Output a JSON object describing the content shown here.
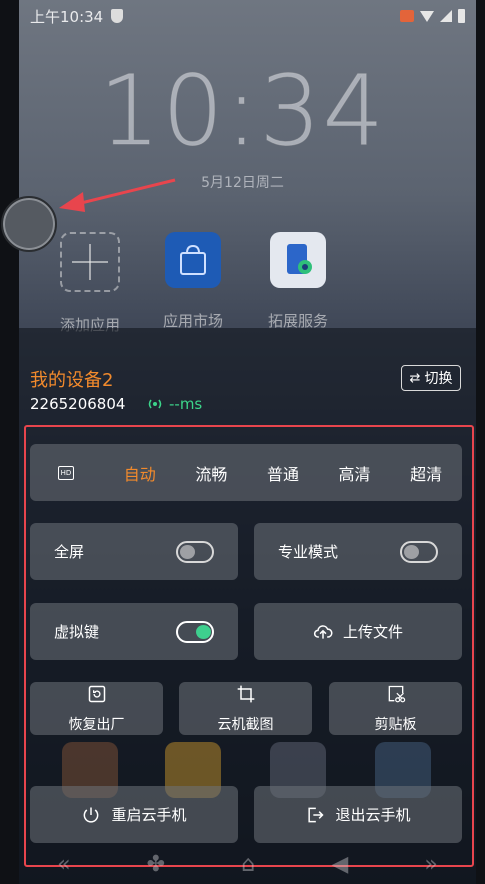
{
  "status": {
    "time": "上午10:34"
  },
  "lock": {
    "clock": "10:34",
    "date": "5月12日周二"
  },
  "apps": [
    {
      "label": "添加应用",
      "icon": "add-app-icon"
    },
    {
      "label": "应用市场",
      "icon": "app-store-icon"
    },
    {
      "label": "拓展服务",
      "icon": "extension-service-icon"
    }
  ],
  "device": {
    "name": "我的设备2",
    "id": "2265206804",
    "ping": "--ms",
    "switch_label": "切换"
  },
  "quality": {
    "options": [
      "自动",
      "流畅",
      "普通",
      "高清",
      "超清"
    ],
    "selected": "自动"
  },
  "toggles": {
    "fullscreen": {
      "label": "全屏",
      "on": false
    },
    "pro_mode": {
      "label": "专业模式",
      "on": false
    },
    "virtual_keys": {
      "label": "虚拟键",
      "on": true
    }
  },
  "actions": {
    "upload": "上传文件",
    "factory_reset": "恢复出厂",
    "screenshot": "云机截图",
    "clipboard": "剪贴板",
    "restart": "重启云手机",
    "exit": "退出云手机"
  },
  "colors": {
    "accent": "#f28a2c",
    "ping_green": "#3cd48a",
    "toggle_on": "#3ecf8e",
    "highlight_border": "#e8454d"
  }
}
